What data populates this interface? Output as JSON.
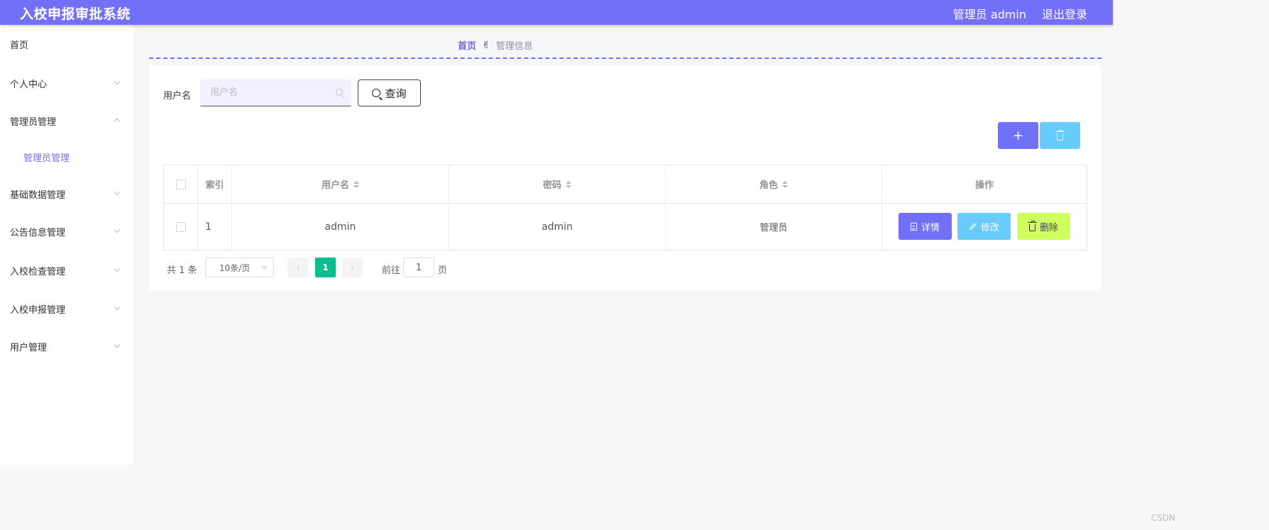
{
  "header": {
    "app_title": "入校申报审批系统",
    "user_label": "管理员 admin",
    "logout_label": "退出登录"
  },
  "sidebar": {
    "items": [
      {
        "label": "首页"
      },
      {
        "label": "个人中心"
      },
      {
        "label": "管理员管理"
      },
      {
        "label": "管理员管理"
      },
      {
        "label": "基础数据管理"
      },
      {
        "label": "公告信息管理"
      },
      {
        "label": "入校检查管理"
      },
      {
        "label": "入校申报管理"
      },
      {
        "label": "用户管理"
      }
    ]
  },
  "breadcrumb": {
    "home": "首页",
    "separator": "✌",
    "current": "管理信息"
  },
  "search": {
    "label": "用户名",
    "placeholder": "用户名",
    "value": "",
    "query_label": "查询"
  },
  "toolbar": {
    "add_label": "+",
    "add_icon": "plus-icon",
    "delete_icon": "trash-icon"
  },
  "table": {
    "columns": [
      "索引",
      "用户名",
      "密码",
      "角色",
      "操作"
    ],
    "rows": [
      {
        "index": "1",
        "username": "admin",
        "password": "admin",
        "role": "管理员"
      }
    ],
    "actions": {
      "detail": "详情",
      "edit": "修改",
      "delete": "删除"
    }
  },
  "pagination": {
    "total": "共 1 条",
    "page_size": "10条/页",
    "current_page": "1",
    "goto_label": "前往",
    "goto_value": "1",
    "page_unit": "页"
  },
  "watermark": "CSDN",
  "colors": {
    "primary": "#7370f8",
    "info": "#67ccfc",
    "warning": "#cfff5f",
    "page_active": "#0abf8d"
  }
}
